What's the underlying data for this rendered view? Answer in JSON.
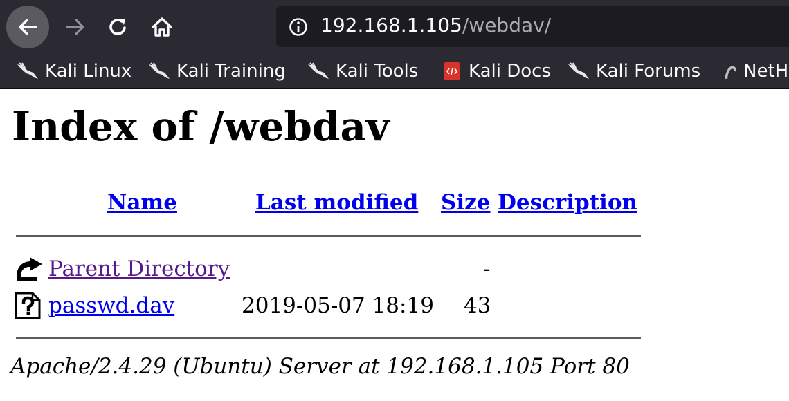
{
  "browser": {
    "url_host": "192.168.1.105",
    "url_path": "/webdav/",
    "bookmarks": [
      {
        "label": "Kali Linux",
        "icon": "kali-dragon-icon"
      },
      {
        "label": "Kali Training",
        "icon": "kali-dragon-icon"
      },
      {
        "label": "Kali Tools",
        "icon": "kali-dragon-icon"
      },
      {
        "label": "Kali Docs",
        "icon": "kali-docs-icon"
      },
      {
        "label": "Kali Forums",
        "icon": "kali-dragon-icon"
      },
      {
        "label": "NetH",
        "icon": "nethunter-icon"
      }
    ]
  },
  "page": {
    "title": "Index of /webdav",
    "columns": {
      "name": "Name",
      "last_modified": "Last modified",
      "size": "Size",
      "description": "Description"
    },
    "rows": [
      {
        "name": "Parent Directory",
        "last_modified": "",
        "size": "-",
        "description": "",
        "icon": "back-arrow-icon"
      },
      {
        "name": "passwd.dav",
        "last_modified": "2019-05-07 18:19",
        "size": "43",
        "description": "",
        "icon": "unknown-file-icon"
      }
    ],
    "address": "Apache/2.4.29 (Ubuntu) Server at 192.168.1.105 Port 80"
  }
}
